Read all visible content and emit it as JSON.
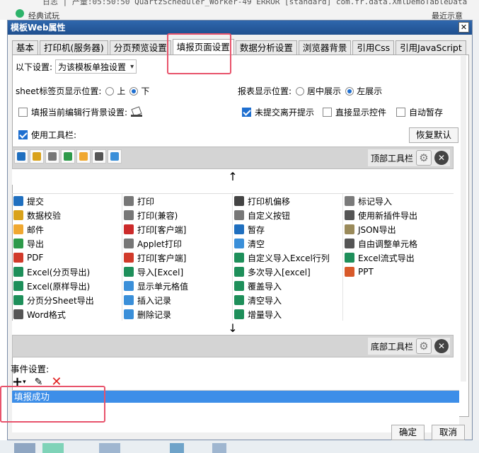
{
  "background": {
    "log_text": "日志  | 产量:05:50:50 QuartzScheduler_Worker-49 ERROR [standard] com.fr.data.XmlDemoTableData",
    "app_label": "经典试玩",
    "right_label": "最近示意"
  },
  "dialog": {
    "title": "模板Web属性",
    "close_glyph": "✕"
  },
  "tabs": [
    {
      "label": "基本",
      "active": false
    },
    {
      "label": "打印机(服务器)",
      "active": false
    },
    {
      "label": "分页预览设置",
      "active": false
    },
    {
      "label": "填报页面设置",
      "active": true
    },
    {
      "label": "数据分析设置",
      "active": false
    },
    {
      "label": "浏览器背景",
      "active": false
    },
    {
      "label": "引用Css",
      "active": false
    },
    {
      "label": "引用JavaScript",
      "active": false
    }
  ],
  "settings": {
    "scope_label": "以下设置:",
    "scope_value": "为该模板单独设置",
    "sheet_pos_label": "sheet标签页显示位置:",
    "sheet_pos_options": [
      "上",
      "下"
    ],
    "sheet_pos_selected": "下",
    "report_pos_label": "报表显示位置:",
    "report_pos_options": [
      "居中展示",
      "左展示"
    ],
    "report_pos_selected": "左展示",
    "fill_bg_label": "填报当前编辑行背景设置:",
    "fill_bg_checked": false,
    "unsubmitted_label": "未提交离开提示",
    "unsubmitted_checked": true,
    "direct_show_label": "直接显示控件",
    "direct_show_checked": false,
    "auto_save_label": "自动暂存",
    "auto_save_checked": false,
    "use_toolbar_label": "使用工具栏:",
    "use_toolbar_checked": true,
    "restore_default_label": "恢复默认"
  },
  "toolbar": {
    "top_label": "顶部工具栏",
    "bottom_label": "底部工具栏",
    "up_arrow": "↑",
    "down_arrow": "↓",
    "top_icons": [
      "save-icon",
      "validate-icon",
      "print-icon",
      "export-icon",
      "email-icon",
      "tree-icon",
      "window-icon"
    ]
  },
  "buttons_grid": [
    [
      {
        "label": "提交",
        "icon": "submit-icon",
        "color": "#1f6fbf"
      },
      {
        "label": "打印",
        "icon": "print-icon",
        "color": "#777777"
      },
      {
        "label": "打印机偏移",
        "icon": "move-icon",
        "color": "#444444"
      },
      {
        "label": "标记导入",
        "icon": "mark-import-icon",
        "color": "#7a7a7a"
      }
    ],
    [
      {
        "label": "数据校验",
        "icon": "validate-icon",
        "color": "#d9a21b"
      },
      {
        "label": "打印(兼容)",
        "icon": "print-compat-icon",
        "color": "#777777"
      },
      {
        "label": "自定义按钮",
        "icon": "custom-button-icon",
        "color": "#777777"
      },
      {
        "label": "使用新插件导出",
        "icon": "word-icon",
        "color": "#555555"
      }
    ],
    [
      {
        "label": "邮件",
        "icon": "email-icon",
        "color": "#f0a830"
      },
      {
        "label": "打印[客户端]",
        "icon": "client-print-icon",
        "color": "#cc2a2a"
      },
      {
        "label": "暂存",
        "icon": "stash-icon",
        "color": "#1f6fbf"
      },
      {
        "label": "JSON导出",
        "icon": "json-icon",
        "color": "#9a8a5a"
      }
    ],
    [
      {
        "label": "导出",
        "icon": "export-icon",
        "color": "#2e9a4a"
      },
      {
        "label": "Applet打印",
        "icon": "applet-print-icon",
        "color": "#777777"
      },
      {
        "label": "清空",
        "icon": "clear-icon",
        "color": "#3a8fd9"
      },
      {
        "label": "自由调整单元格",
        "icon": "grid-adjust-icon",
        "color": "#555555"
      }
    ],
    [
      {
        "label": "PDF",
        "icon": "pdf-icon",
        "color": "#d13a2a"
      },
      {
        "label": "打印[客户端]",
        "icon": "client-print-icon",
        "color": "#d13a2a"
      },
      {
        "label": "自定义导入Excel行列",
        "icon": "excel-icon",
        "color": "#1e8f5a"
      },
      {
        "label": "Excel流式导出",
        "icon": "excel-icon",
        "color": "#1e8f5a"
      }
    ],
    [
      {
        "label": "Excel(分页导出)",
        "icon": "excel-icon",
        "color": "#1e8f5a"
      },
      {
        "label": "导入[Excel]",
        "icon": "excel-icon",
        "color": "#1e8f5a"
      },
      {
        "label": "多次导入[excel]",
        "icon": "excel-icon",
        "color": "#1e8f5a"
      },
      {
        "label": "PPT",
        "icon": "ppt-icon",
        "color": "#d85a2a"
      }
    ],
    [
      {
        "label": "Excel(原样导出)",
        "icon": "excel-icon",
        "color": "#1e8f5a"
      },
      {
        "label": "显示单元格值",
        "icon": "cell-value-icon",
        "color": "#3a8fd9"
      },
      {
        "label": "覆盖导入",
        "icon": "excel-icon",
        "color": "#1e8f5a"
      },
      {
        "label": "",
        "icon": "",
        "color": ""
      }
    ],
    [
      {
        "label": "分页分Sheet导出",
        "icon": "excel-icon",
        "color": "#1e8f5a"
      },
      {
        "label": "插入记录",
        "icon": "insert-row-icon",
        "color": "#3a8fd9"
      },
      {
        "label": "清空导入",
        "icon": "excel-icon",
        "color": "#1e8f5a"
      },
      {
        "label": "",
        "icon": "",
        "color": ""
      }
    ],
    [
      {
        "label": "Word格式",
        "icon": "word-icon",
        "color": "#555555"
      },
      {
        "label": "删除记录",
        "icon": "delete-row-icon",
        "color": "#3a8fd9"
      },
      {
        "label": "增量导入",
        "icon": "excel-icon",
        "color": "#1e8f5a"
      },
      {
        "label": "",
        "icon": "",
        "color": ""
      }
    ]
  ],
  "events": {
    "label": "事件设置:",
    "items": [
      "填报成功"
    ]
  },
  "footer": {
    "ok_label": "确定",
    "cancel_label": "取消"
  },
  "colors": {
    "accent": "#1e6fd0",
    "highlight": "#e8536b",
    "selection": "#3d8ee8"
  }
}
